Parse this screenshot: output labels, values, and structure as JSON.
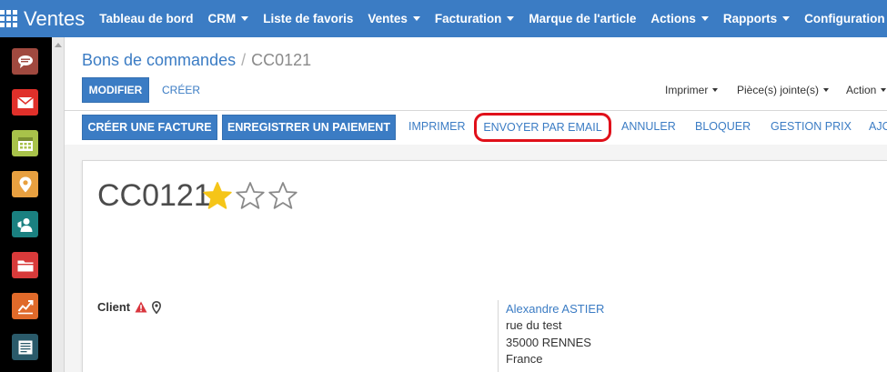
{
  "app": {
    "title": "Ventes"
  },
  "topnav": {
    "items": [
      {
        "label": "Tableau de bord",
        "dropdown": false
      },
      {
        "label": "CRM",
        "dropdown": true
      },
      {
        "label": "Liste de favoris",
        "dropdown": false
      },
      {
        "label": "Ventes",
        "dropdown": true
      },
      {
        "label": "Facturation",
        "dropdown": true
      },
      {
        "label": "Marque de l'article",
        "dropdown": false
      },
      {
        "label": "Actions",
        "dropdown": true
      },
      {
        "label": "Rapports",
        "dropdown": true
      },
      {
        "label": "Configuration",
        "dropdown": true
      }
    ]
  },
  "sidebar": {
    "icons": [
      {
        "name": "chat-icon",
        "color": "#a0493f"
      },
      {
        "name": "mail-icon",
        "color": "#e0302a"
      },
      {
        "name": "calendar-icon",
        "color": "#a8c24a"
      },
      {
        "name": "map-pin-icon",
        "color": "#e8a040"
      },
      {
        "name": "contacts-icon",
        "color": "#1a8080"
      },
      {
        "name": "folder-icon",
        "color": "#d83a3a"
      },
      {
        "name": "chart-icon",
        "color": "#e06a2a"
      },
      {
        "name": "report-icon",
        "color": "#2a5a6a"
      }
    ]
  },
  "breadcrumb": {
    "parent": "Bons de commandes",
    "separator": "/",
    "current": "CC0121"
  },
  "controls": {
    "modifier": "MODIFIER",
    "creer": "CRÉER",
    "imprimer": "Imprimer",
    "pieces": "Pièce(s) jointe(s)",
    "action": "Action"
  },
  "statusbar": {
    "creer_facture": "CRÉER UNE FACTURE",
    "enregistrer_paiement": "ENREGISTRER UN PAIEMENT",
    "imprimer": "IMPRIMER",
    "envoyer_email": "ENVOYER PAR EMAIL",
    "annuler": "ANNULER",
    "bloquer": "BLOQUER",
    "gestion_prix": "GESTION PRIX",
    "truncated": "AJO"
  },
  "record": {
    "name": "CC0121",
    "stars": {
      "value": 1,
      "max": 3
    },
    "client_label": "Client",
    "client": {
      "name": "Alexandre ASTIER",
      "street": "rue du test",
      "city": "35000 RENNES",
      "country": "France"
    }
  },
  "colors": {
    "primary": "#3b7cc4",
    "highlight": "#e0101a",
    "star": "#f5c518",
    "warning": "#d9363e"
  }
}
